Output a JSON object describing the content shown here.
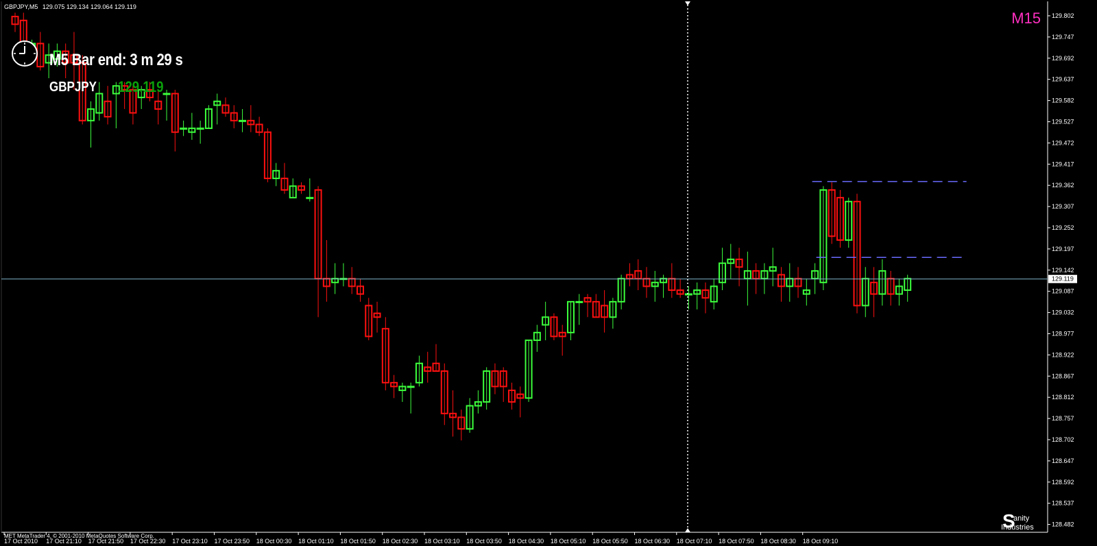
{
  "header": {
    "symbol_tf": "GBPJPY,M5",
    "ohlc": "129.075 129.134 129.064 129.119"
  },
  "indicator": {
    "timeframe_label": "M15",
    "bar_end_text": "M5 Bar end: 3 m 29 s",
    "symbol": "GBPJPY",
    "symbol_price": "129.119"
  },
  "footer": {
    "copyright": "MET MetaTrader 4, © 2001-2010 MetaQuotes Software Corp.",
    "brand_line1": "anity",
    "brand_line2": "Industries",
    "brand_letter": "S"
  },
  "colors": {
    "bull": "#3cff3c",
    "bear": "#ff1010",
    "axis": "#ffffff",
    "bid_line": "#7fb3c7",
    "levels": "#6a6aff",
    "timeframe": "#ff2fc0"
  },
  "icons": [
    "clock-icon"
  ],
  "chart_data": {
    "type": "candlestick",
    "symbol": "GBPJPY",
    "timeframe": "M5",
    "current_price": 129.119,
    "y_ticks": [
      "129.802",
      "129.747",
      "129.692",
      "129.637",
      "129.582",
      "129.527",
      "129.472",
      "129.417",
      "129.362",
      "129.307",
      "129.252",
      "129.197",
      "129.142",
      "129.087",
      "129.032",
      "128.977",
      "128.922",
      "128.867",
      "128.812",
      "128.757",
      "128.702",
      "128.647",
      "128.592",
      "128.537",
      "128.482"
    ],
    "ylim": [
      128.48,
      129.81
    ],
    "x_ticks": [
      "17 Oct 2010",
      "17 Oct 21:10",
      "17 Oct 21:50",
      "17 Oct 22:30",
      "17 Oct 23:10",
      "17 Oct 23:50",
      "18 Oct 00:30",
      "18 Oct 01:10",
      "18 Oct 01:50",
      "18 Oct 02:30",
      "18 Oct 03:10",
      "18 Oct 03:50",
      "18 Oct 04:30",
      "18 Oct 05:10",
      "18 Oct 05:50",
      "18 Oct 06:30",
      "18 Oct 07:10",
      "18 Oct 07:50",
      "18 Oct 08:30",
      "18 Oct 09:10"
    ],
    "levels": [
      129.372,
      129.175
    ],
    "candles": [
      [
        129.8,
        129.81,
        129.76,
        129.78
      ],
      [
        129.79,
        129.81,
        129.7,
        129.72
      ],
      [
        129.72,
        129.74,
        129.7,
        129.73
      ],
      [
        129.73,
        129.76,
        129.66,
        129.67
      ],
      [
        129.68,
        129.73,
        129.64,
        129.7
      ],
      [
        129.69,
        129.73,
        129.67,
        129.71
      ],
      [
        129.71,
        129.73,
        129.64,
        129.68
      ],
      [
        129.7,
        129.76,
        129.61,
        129.68
      ],
      [
        129.68,
        129.7,
        129.52,
        129.53
      ],
      [
        129.53,
        129.58,
        129.46,
        129.56
      ],
      [
        129.55,
        129.63,
        129.53,
        129.6
      ],
      [
        129.58,
        129.62,
        129.52,
        129.54
      ],
      [
        129.6,
        129.63,
        129.51,
        129.62
      ],
      [
        129.62,
        129.63,
        129.56,
        129.61
      ],
      [
        129.61,
        129.62,
        129.52,
        129.55
      ],
      [
        129.59,
        129.62,
        129.56,
        129.61
      ],
      [
        129.61,
        129.63,
        129.58,
        129.59
      ],
      [
        129.58,
        129.61,
        129.52,
        129.56
      ],
      [
        129.6,
        129.61,
        129.53,
        129.6
      ],
      [
        129.6,
        129.61,
        129.45,
        129.5
      ],
      [
        129.51,
        129.53,
        129.49,
        129.51
      ],
      [
        129.5,
        129.55,
        129.48,
        129.51
      ],
      [
        129.51,
        129.53,
        129.47,
        129.51
      ],
      [
        129.51,
        129.57,
        129.51,
        129.56
      ],
      [
        129.57,
        129.6,
        129.52,
        129.58
      ],
      [
        129.57,
        129.59,
        129.54,
        129.55
      ],
      [
        129.55,
        129.57,
        129.51,
        129.53
      ],
      [
        129.53,
        129.56,
        129.5,
        129.53
      ],
      [
        129.53,
        129.57,
        129.5,
        129.52
      ],
      [
        129.52,
        129.54,
        129.49,
        129.5
      ],
      [
        129.5,
        129.51,
        129.37,
        129.38
      ],
      [
        129.38,
        129.42,
        129.36,
        129.4
      ],
      [
        129.38,
        129.42,
        129.34,
        129.35
      ],
      [
        129.33,
        129.38,
        129.33,
        129.36
      ],
      [
        129.36,
        129.37,
        129.34,
        129.35
      ],
      [
        129.33,
        129.38,
        129.32,
        129.33
      ],
      [
        129.35,
        129.36,
        129.02,
        129.12
      ],
      [
        129.12,
        129.22,
        129.06,
        129.1
      ],
      [
        129.11,
        129.16,
        129.08,
        129.12
      ],
      [
        129.12,
        129.16,
        129.1,
        129.12
      ],
      [
        129.12,
        129.15,
        129.08,
        129.1
      ],
      [
        129.1,
        129.12,
        129.06,
        129.08
      ],
      [
        129.05,
        129.07,
        128.96,
        128.97
      ],
      [
        129.03,
        129.06,
        128.98,
        129.02
      ],
      [
        128.99,
        129.02,
        128.83,
        128.85
      ],
      [
        128.85,
        128.87,
        128.81,
        128.84
      ],
      [
        128.83,
        128.85,
        128.8,
        128.84
      ],
      [
        128.84,
        128.85,
        128.77,
        128.84
      ],
      [
        128.85,
        128.92,
        128.84,
        128.9
      ],
      [
        128.89,
        128.93,
        128.85,
        128.88
      ],
      [
        128.9,
        128.95,
        128.88,
        128.88
      ],
      [
        128.88,
        128.9,
        128.74,
        128.77
      ],
      [
        128.77,
        128.83,
        128.71,
        128.76
      ],
      [
        128.76,
        128.78,
        128.7,
        128.73
      ],
      [
        128.73,
        128.81,
        128.72,
        128.79
      ],
      [
        128.79,
        128.83,
        128.77,
        128.8
      ],
      [
        128.8,
        128.89,
        128.78,
        128.88
      ],
      [
        128.88,
        128.9,
        128.82,
        128.84
      ],
      [
        128.88,
        128.89,
        128.8,
        128.84
      ],
      [
        128.83,
        128.85,
        128.78,
        128.8
      ],
      [
        128.82,
        128.84,
        128.76,
        128.81
      ],
      [
        128.81,
        128.96,
        128.8,
        128.96
      ],
      [
        128.96,
        129.0,
        128.93,
        128.98
      ],
      [
        129.0,
        129.06,
        128.96,
        129.02
      ],
      [
        129.02,
        129.03,
        128.96,
        128.97
      ],
      [
        128.98,
        129.0,
        128.92,
        128.97
      ],
      [
        128.98,
        129.06,
        128.96,
        129.06
      ],
      [
        129.06,
        129.08,
        129.0,
        129.06
      ],
      [
        129.07,
        129.08,
        129.02,
        129.06
      ],
      [
        129.06,
        129.08,
        129.02,
        129.02
      ],
      [
        129.05,
        129.09,
        128.98,
        129.02
      ],
      [
        129.02,
        129.07,
        128.99,
        129.06
      ],
      [
        129.06,
        129.13,
        129.04,
        129.12
      ],
      [
        129.13,
        129.16,
        129.1,
        129.12
      ],
      [
        129.14,
        129.17,
        129.09,
        129.12
      ],
      [
        129.12,
        129.15,
        129.07,
        129.1
      ],
      [
        129.1,
        129.14,
        129.06,
        129.11
      ],
      [
        129.11,
        129.13,
        129.07,
        129.12
      ],
      [
        129.12,
        129.16,
        129.07,
        129.09
      ],
      [
        129.09,
        129.12,
        129.07,
        129.08
      ],
      [
        129.08,
        129.1,
        129.04,
        129.08
      ],
      [
        129.08,
        129.11,
        129.04,
        129.09
      ],
      [
        129.09,
        129.11,
        129.03,
        129.07
      ],
      [
        129.06,
        129.12,
        129.04,
        129.1
      ],
      [
        129.11,
        129.2,
        129.09,
        129.16
      ],
      [
        129.16,
        129.21,
        129.12,
        129.17
      ],
      [
        129.17,
        129.2,
        129.1,
        129.15
      ],
      [
        129.12,
        129.19,
        129.05,
        129.14
      ],
      [
        129.14,
        129.16,
        129.08,
        129.12
      ],
      [
        129.12,
        129.16,
        129.08,
        129.14
      ],
      [
        129.14,
        129.2,
        129.1,
        129.15
      ],
      [
        129.13,
        129.15,
        129.06,
        129.1
      ],
      [
        129.1,
        129.16,
        129.06,
        129.12
      ],
      [
        129.12,
        129.15,
        129.07,
        129.1
      ],
      [
        129.08,
        129.12,
        129.05,
        129.09
      ],
      [
        129.12,
        129.16,
        129.08,
        129.14
      ],
      [
        129.11,
        129.36,
        129.09,
        129.35
      ],
      [
        129.35,
        129.37,
        129.21,
        129.23
      ],
      [
        129.33,
        129.35,
        129.2,
        129.22
      ],
      [
        129.22,
        129.33,
        129.2,
        129.32
      ],
      [
        129.32,
        129.34,
        129.03,
        129.05
      ],
      [
        129.05,
        129.15,
        129.02,
        129.12
      ],
      [
        129.11,
        129.15,
        129.02,
        129.08
      ],
      [
        129.08,
        129.17,
        129.05,
        129.14
      ],
      [
        129.12,
        129.14,
        129.05,
        129.08
      ],
      [
        129.08,
        129.12,
        129.05,
        129.1
      ],
      [
        129.09,
        129.13,
        129.06,
        129.12
      ]
    ]
  }
}
